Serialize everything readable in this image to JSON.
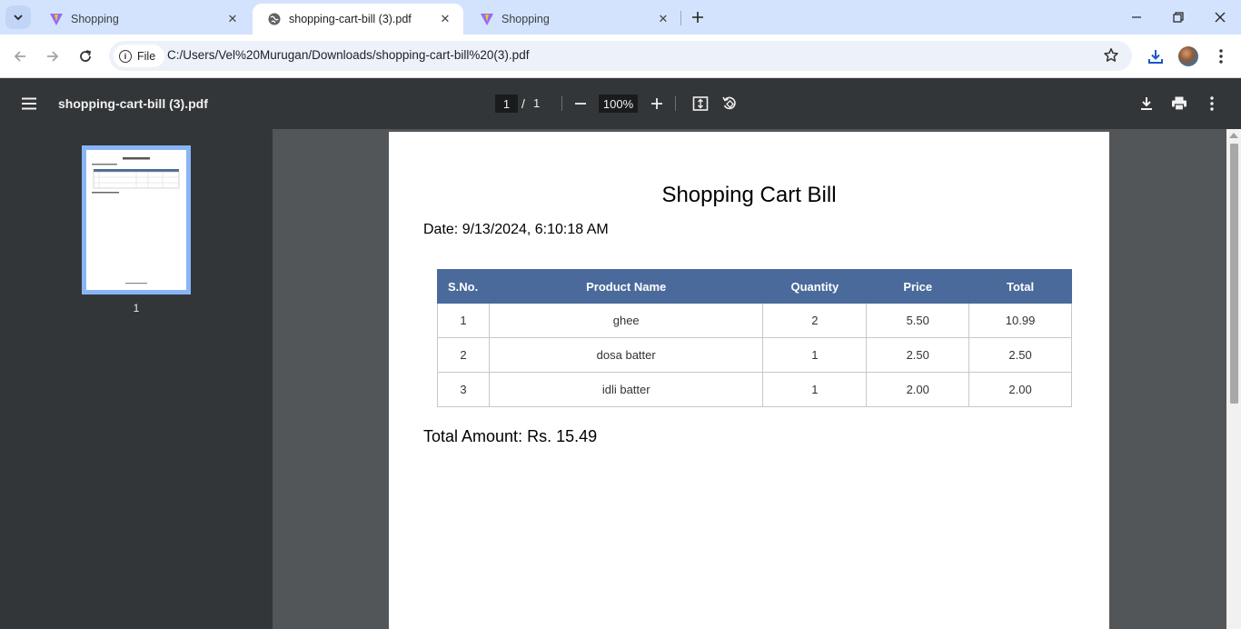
{
  "browser": {
    "tabs": [
      {
        "title": "Shopping",
        "active": false
      },
      {
        "title": "shopping-cart-bill (3).pdf",
        "active": true
      },
      {
        "title": "Shopping",
        "active": false
      }
    ],
    "omnibox": {
      "chip_label": "File",
      "url": "C:/Users/Vel%20Murugan/Downloads/shopping-cart-bill%20(3).pdf"
    }
  },
  "pdf_viewer": {
    "file_title": "shopping-cart-bill (3).pdf",
    "current_page": "1",
    "page_separator": "/",
    "total_pages": "1",
    "zoom": "100%",
    "thumbnail_label": "1"
  },
  "document": {
    "title": "Shopping Cart Bill",
    "date": "Date: 9/13/2024, 6:10:18 AM",
    "columns": [
      "S.No.",
      "Product Name",
      "Quantity",
      "Price",
      "Total"
    ],
    "rows": [
      [
        "1",
        "ghee",
        "2",
        "5.50",
        "10.99"
      ],
      [
        "2",
        "dosa batter",
        "1",
        "2.50",
        "2.50"
      ],
      [
        "3",
        "idli batter",
        "1",
        "2.00",
        "2.00"
      ]
    ],
    "total_amount": "Total Amount: Rs. 15.49"
  },
  "colors": {
    "table_header": "#4a6a9b",
    "viewer_toolbar": "#323639",
    "viewer_background": "#525659",
    "tabstrip": "#d3e3fd"
  }
}
